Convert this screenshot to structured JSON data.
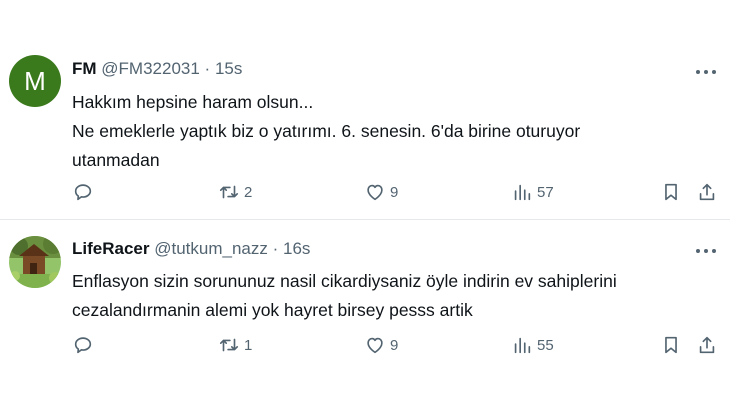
{
  "tweets": [
    {
      "avatar_letter": "M",
      "avatar_color": "#3b7a1c",
      "display_name": "FM",
      "handle": "@FM322031",
      "time": "15s",
      "text_lines": [
        "Hakkım hepsine haram olsun...",
        "Ne emeklerle yaptık biz o yatırımı. 6. senesin. 6'da birine oturuyor",
        "utanmadan"
      ],
      "retweets": "2",
      "likes": "9",
      "views": "57"
    },
    {
      "display_name": "LifeRacer",
      "handle": "@tutkum_nazz",
      "time": "16s",
      "text_lines": [
        "Enflasyon sizin sorununuz nasil cikardiysaniz öyle indirin ev sahiplerini",
        "cezalandırmanin alemi yok hayret birsey pesss artik"
      ],
      "retweets": "1",
      "likes": "9",
      "views": "55"
    }
  ],
  "separator": "·",
  "icons": [
    "reply-icon",
    "retweet-icon",
    "like-icon",
    "views-icon",
    "bookmark-icon",
    "share-icon",
    "more-icon"
  ]
}
